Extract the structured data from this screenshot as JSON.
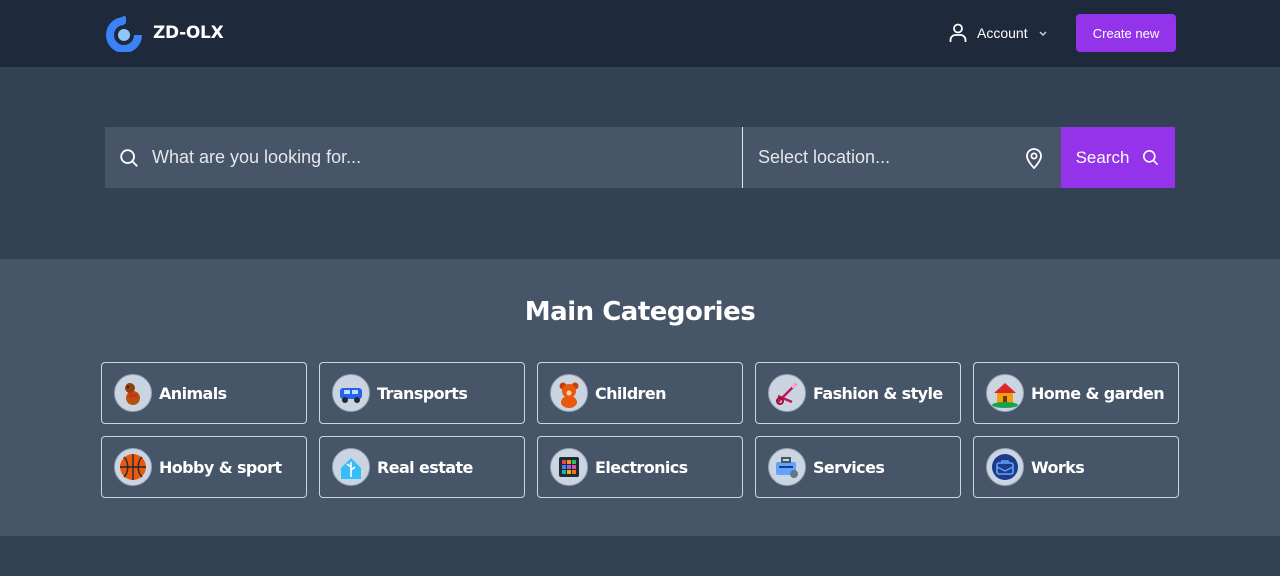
{
  "header": {
    "brand": "ZD-OLX",
    "account_label": "Account",
    "create_label": "Create new"
  },
  "search": {
    "query_placeholder": "What are you looking for...",
    "location_placeholder": "Select location...",
    "button_label": "Search"
  },
  "categories": {
    "title": "Main Categories",
    "items": [
      {
        "label": "Animals",
        "icon": "dog-icon"
      },
      {
        "label": "Transports",
        "icon": "car-icon"
      },
      {
        "label": "Children",
        "icon": "teddy-bear-icon"
      },
      {
        "label": "Fashion & style",
        "icon": "scissors-icon"
      },
      {
        "label": "Home & garden",
        "icon": "house-icon"
      },
      {
        "label": "Hobby & sport",
        "icon": "basketball-icon"
      },
      {
        "label": "Real estate",
        "icon": "house-tree-icon"
      },
      {
        "label": "Electronics",
        "icon": "tablet-icon"
      },
      {
        "label": "Services",
        "icon": "toolbox-icon"
      },
      {
        "label": "Works",
        "icon": "briefcase-icon"
      }
    ]
  },
  "colors": {
    "navbar": "#1e293b",
    "hero": "#334155",
    "panel": "#475569",
    "accent": "#9333ea",
    "logo_blue": "#3b82f6"
  }
}
